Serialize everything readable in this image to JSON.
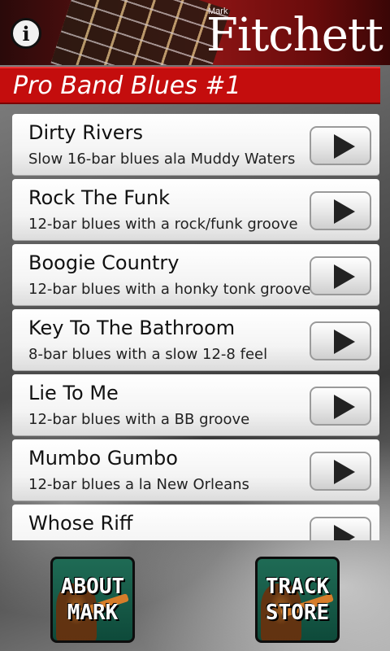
{
  "header": {
    "info_icon": "info-icon",
    "brand_first": "Mark",
    "brand_last": "Fitchett"
  },
  "page_title": "Pro Band Blues #1",
  "tracks": [
    {
      "name": "Dirty Rivers",
      "desc": "Slow 16-bar blues ala Muddy Waters"
    },
    {
      "name": "Rock The Funk",
      "desc": "12-bar blues with a rock/funk groove"
    },
    {
      "name": "Boogie Country",
      "desc": "12-bar blues with a honky tonk groove"
    },
    {
      "name": "Key To The Bathroom",
      "desc": "8-bar blues with a slow 12-8 feel"
    },
    {
      "name": "Lie To Me",
      "desc": "12-bar blues with a BB groove"
    },
    {
      "name": "Mumbo Gumbo",
      "desc": "12-bar blues a la New Orleans"
    },
    {
      "name": "Whose Riff",
      "desc": ""
    }
  ],
  "bottom": {
    "about_line1": "ABOUT",
    "about_line2": "MARK",
    "store_line1": "TRACK",
    "store_line2": "STORE"
  },
  "colors": {
    "title_bar": "#c40d0d",
    "header_dark": "#5a1010",
    "button_green": "#1f6b55"
  }
}
